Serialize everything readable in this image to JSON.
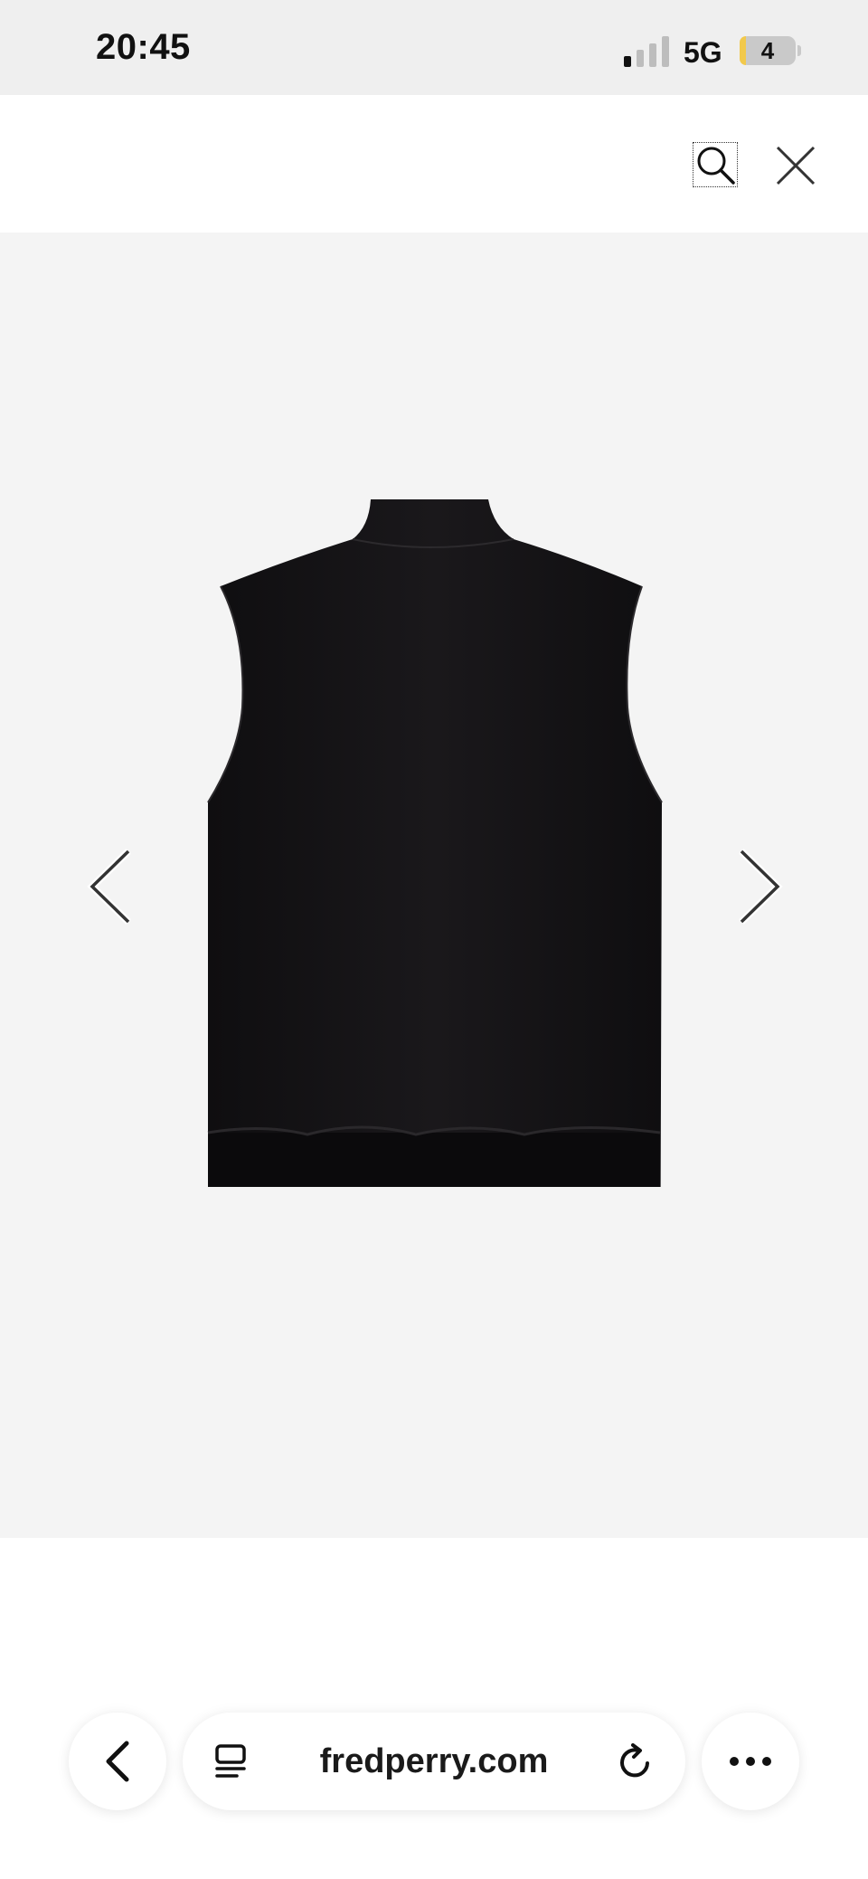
{
  "status_bar": {
    "time": "20:45",
    "network": "5G",
    "battery_level": "4",
    "battery_fraction": 0.04
  },
  "toolbar": {
    "search_icon": "magnifier-icon",
    "close_icon": "close-icon"
  },
  "gallery": {
    "product_image": "black sleeveless vest (back view)",
    "prev_icon": "chevron-left-icon",
    "next_icon": "chevron-right-icon",
    "background_color": "#f4f4f4"
  },
  "browser_bar": {
    "url": "fredperry.com",
    "back_icon": "chevron-left-icon",
    "reader_icon": "reader-icon",
    "reload_icon": "reload-icon",
    "more_icon": "ellipsis-icon"
  }
}
